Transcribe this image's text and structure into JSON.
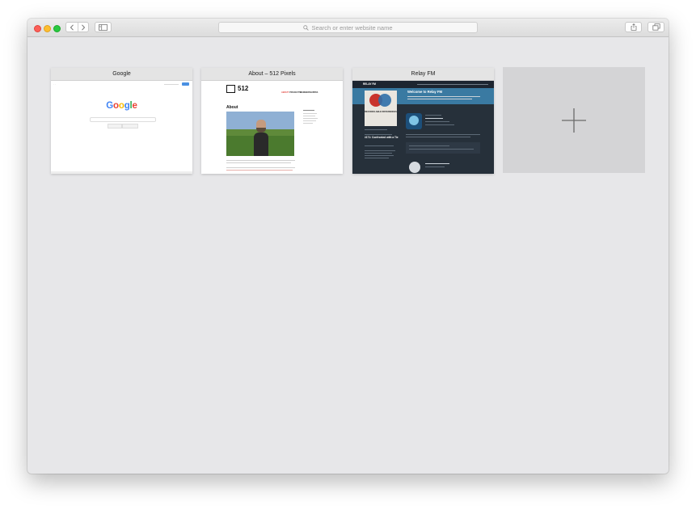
{
  "toolbar": {
    "search_placeholder": "Search or enter website name"
  },
  "tabs": [
    {
      "title": "Google",
      "preview": {
        "logo_letters": [
          "G",
          "o",
          "o",
          "g",
          "l",
          "e"
        ],
        "logo_colors": [
          "#4285f4",
          "#ea4335",
          "#fbbc05",
          "#4285f4",
          "#34a853",
          "#ea4335"
        ]
      }
    },
    {
      "title": "About – 512 Pixels",
      "preview": {
        "logo": "512",
        "nav": [
          "ABOUT",
          "PROJECTS",
          "MEMBERSHIP",
          "RSS"
        ],
        "heading": "About"
      }
    },
    {
      "title": "Relay FM",
      "preview": {
        "logo": "RELAY FM",
        "welcome": "Welcome to Relay FM",
        "card": "RECONCILABLE DIFFERENCES",
        "episode": "#171: Confronted with a Tie"
      }
    }
  ],
  "colors": {
    "close": "#fc5f57",
    "minimize": "#fdbd2e",
    "zoom": "#28c840",
    "relay_hero": "#3a7aa2"
  }
}
